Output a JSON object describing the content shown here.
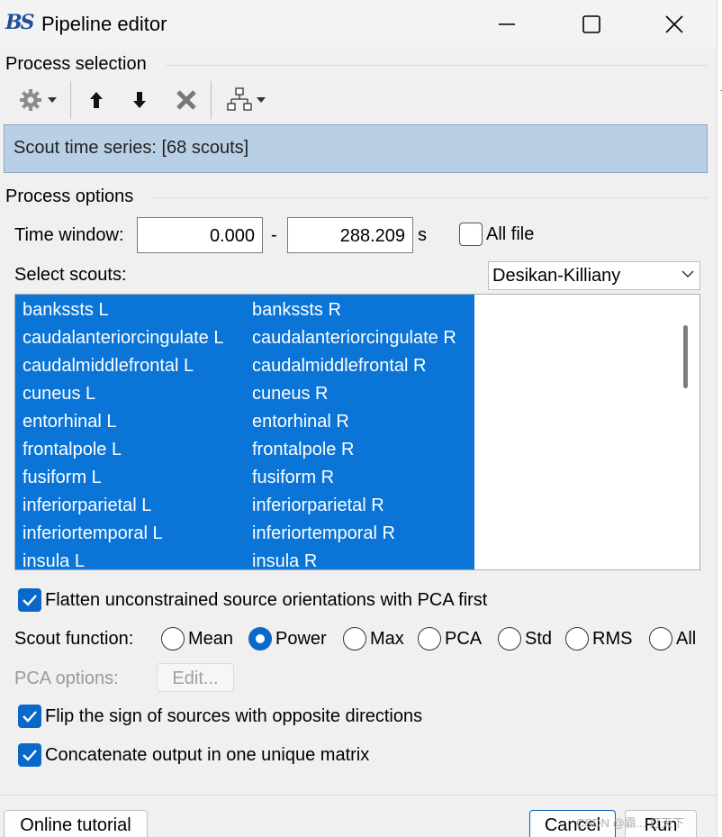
{
  "window": {
    "logo_text": "BS",
    "title": "Pipeline editor",
    "controls": {
      "minimize": "minimize",
      "maximize": "maximize",
      "close": "close"
    }
  },
  "process_selection": {
    "label": "Process selection",
    "toolbar": {
      "icons": [
        "gear-icon",
        "chevron-down-icon",
        "arrow-up-icon",
        "arrow-down-icon",
        "delete-x-icon",
        "pipeline-tree-icon",
        "chevron-down-icon"
      ]
    },
    "selected_process": "Scout time series: [68 scouts]"
  },
  "process_options": {
    "label": "Process options",
    "time_window": {
      "label": "Time window:",
      "start": "0.000",
      "dash": "-",
      "end": "288.209",
      "unit": "s"
    },
    "all_file": {
      "label": "All file",
      "checked": false
    },
    "select_scouts": {
      "label": "Select scouts:",
      "atlas": "Desikan-Killiany"
    },
    "scouts": [
      [
        "bankssts L",
        "bankssts R"
      ],
      [
        "caudalanteriorcingulate L",
        "caudalanteriorcingulate R"
      ],
      [
        "caudalmiddlefrontal L",
        "caudalmiddlefrontal R"
      ],
      [
        "cuneus L",
        "cuneus R"
      ],
      [
        "entorhinal L",
        "entorhinal R"
      ],
      [
        "frontalpole L",
        "frontalpole R"
      ],
      [
        "fusiform L",
        "fusiform R"
      ],
      [
        "inferiorparietal L",
        "inferiorparietal R"
      ],
      [
        "inferiortemporal L",
        "inferiortemporal R"
      ],
      [
        "insula L",
        "insula R"
      ]
    ],
    "flatten": {
      "label": "Flatten unconstrained source orientations with PCA first",
      "checked": true
    },
    "scout_function": {
      "label": "Scout function:",
      "options": [
        "Mean",
        "Power",
        "Max",
        "PCA",
        "Std",
        "RMS",
        "All"
      ],
      "selected": "Power"
    },
    "pca_options": {
      "label": "PCA options:",
      "button": "Edit..."
    },
    "flip_sign": {
      "label": "Flip the sign of sources with opposite directions",
      "checked": true
    },
    "concatenate": {
      "label": "Concatenate output in one unique matrix",
      "checked": true
    }
  },
  "footer": {
    "online_tutorial": "Online tutorial",
    "cancel": "Cancel",
    "run": "Run",
    "watermark": "CSDN @霸... 打天下"
  },
  "colors": {
    "selection_blue": "#0a74d7",
    "checkbox_blue": "#0a69c8",
    "process_row_bg": "#b8cfe6"
  }
}
